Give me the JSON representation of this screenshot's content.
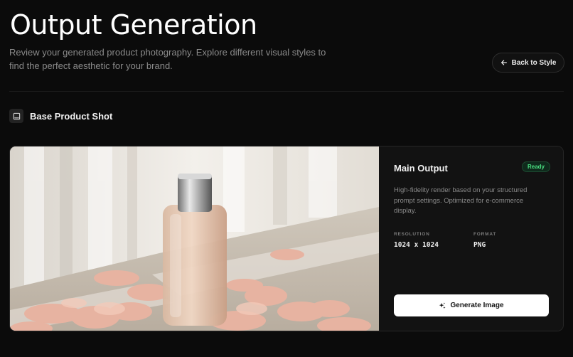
{
  "header": {
    "title": "Output Generation",
    "subtitle": "Review your generated product photography. Explore different visual styles to find the perfect aesthetic for your brand.",
    "back_label": "Back to Style"
  },
  "section": {
    "title": "Base Product Shot",
    "icon": "image-icon"
  },
  "output": {
    "title": "Main Output",
    "status": "Ready",
    "description": "High-fidelity render based on your structured prompt settings. Optimized for e-commerce display.",
    "resolution_label": "RESOLUTION",
    "resolution_value": "1024 x 1024",
    "format_label": "FORMAT",
    "format_value": "PNG",
    "generate_label": "Generate Image"
  },
  "colors": {
    "background": "#0b0b0b",
    "card": "#121212",
    "status_green": "#4ade80",
    "button_bg": "#ffffff"
  }
}
